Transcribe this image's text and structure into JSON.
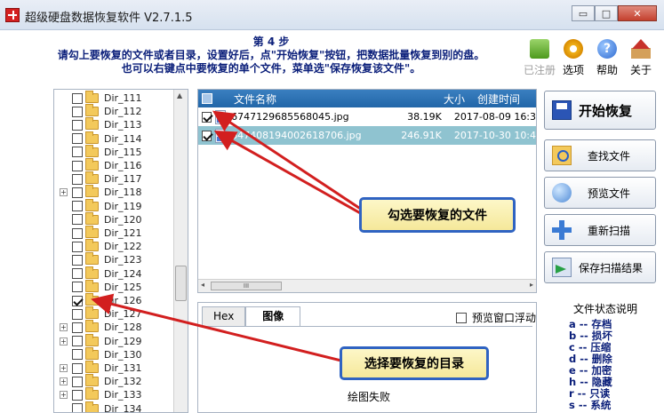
{
  "window": {
    "title": "超级硬盘数据恢复软件 V2.7.1.5",
    "minimize_glyph": "▭",
    "maximize_glyph": "□",
    "close_glyph": "✕"
  },
  "instructions": {
    "step": "第 4 步",
    "line1": "请勾上要恢复的文件或者目录，设置好后，点\"开始恢复\"按钮，把数据批量恢复到别的盘。",
    "line2": "也可以右键点中要恢复的单个文件，菜单选\"保存恢复该文件\"。"
  },
  "toolbar": {
    "items": [
      {
        "label": "已注册",
        "icon": "cart-icon",
        "disabled": true
      },
      {
        "label": "选项",
        "icon": "gear-icon",
        "disabled": false
      },
      {
        "label": "帮助",
        "icon": "help-icon",
        "disabled": false
      },
      {
        "label": "关于",
        "icon": "house-icon",
        "disabled": false
      }
    ],
    "help_glyph": "?"
  },
  "tree": {
    "items": [
      {
        "label": "Dir_111",
        "expandable": false,
        "checked": false
      },
      {
        "label": "Dir_112",
        "expandable": false,
        "checked": false
      },
      {
        "label": "Dir_113",
        "expandable": false,
        "checked": false
      },
      {
        "label": "Dir_114",
        "expandable": false,
        "checked": false
      },
      {
        "label": "Dir_115",
        "expandable": false,
        "checked": false
      },
      {
        "label": "Dir_116",
        "expandable": false,
        "checked": false
      },
      {
        "label": "Dir_117",
        "expandable": false,
        "checked": false
      },
      {
        "label": "Dir_118",
        "expandable": true,
        "checked": false
      },
      {
        "label": "Dir_119",
        "expandable": false,
        "checked": false
      },
      {
        "label": "Dir_120",
        "expandable": false,
        "checked": false
      },
      {
        "label": "Dir_121",
        "expandable": false,
        "checked": false
      },
      {
        "label": "Dir_122",
        "expandable": false,
        "checked": false
      },
      {
        "label": "Dir_123",
        "expandable": false,
        "checked": false
      },
      {
        "label": "Dir_124",
        "expandable": false,
        "checked": false
      },
      {
        "label": "Dir_125",
        "expandable": false,
        "checked": false
      },
      {
        "label": "Dir_126",
        "expandable": false,
        "checked": true
      },
      {
        "label": "Dir_127",
        "expandable": false,
        "checked": false
      },
      {
        "label": "Dir_128",
        "expandable": true,
        "checked": false
      },
      {
        "label": "Dir_129",
        "expandable": true,
        "checked": false
      },
      {
        "label": "Dir_130",
        "expandable": false,
        "checked": false
      },
      {
        "label": "Dir_131",
        "expandable": true,
        "checked": false
      },
      {
        "label": "Dir_132",
        "expandable": true,
        "checked": false
      },
      {
        "label": "Dir_133",
        "expandable": true,
        "checked": false
      },
      {
        "label": "Dir_134",
        "expandable": false,
        "checked": false
      }
    ],
    "expander_glyph": "+",
    "scroll_up_glyph": "▲"
  },
  "filelist": {
    "columns": {
      "name": "文件名称",
      "size": "大小",
      "time": "创建时间"
    },
    "rows": [
      {
        "name": "6747129685568045.jpg",
        "size": "38.19K",
        "time": "2017-08-09 16:3",
        "checked": true,
        "selected": false
      },
      {
        "name": "6474081940026187​06.jpg",
        "size": "246.91K",
        "time": "2017-10-30 10:4",
        "checked": true,
        "selected": true
      }
    ],
    "scroll_left_glyph": "◂",
    "scroll_right_glyph": "▸",
    "scroll_thumb_glyph": "III"
  },
  "preview": {
    "tabs": [
      "Hex",
      "图像"
    ],
    "float_label": "预览窗口浮动",
    "fail_text": "绘图失败"
  },
  "actions": {
    "start": "开始恢复",
    "find": "查找文件",
    "preview": "预览文件",
    "rescan": "重新扫描",
    "save_scan": "保存扫描结果"
  },
  "legend": {
    "title": "文件状态说明",
    "rows": [
      "a -- 存档",
      "b -- 损坏",
      "c -- 压缩",
      "d -- 删除",
      "e -- 加密",
      "h -- 隐藏",
      "r -- 只读",
      "s -- 系统"
    ]
  },
  "callouts": {
    "files": "勾选要恢复的文件",
    "dir": "选择要恢复的目录"
  },
  "colors": {
    "header_blue": "#2266a8",
    "selected_row": "#8fc3d0",
    "callout_border": "#2f63c2",
    "arrow_red": "#d21f1f"
  }
}
